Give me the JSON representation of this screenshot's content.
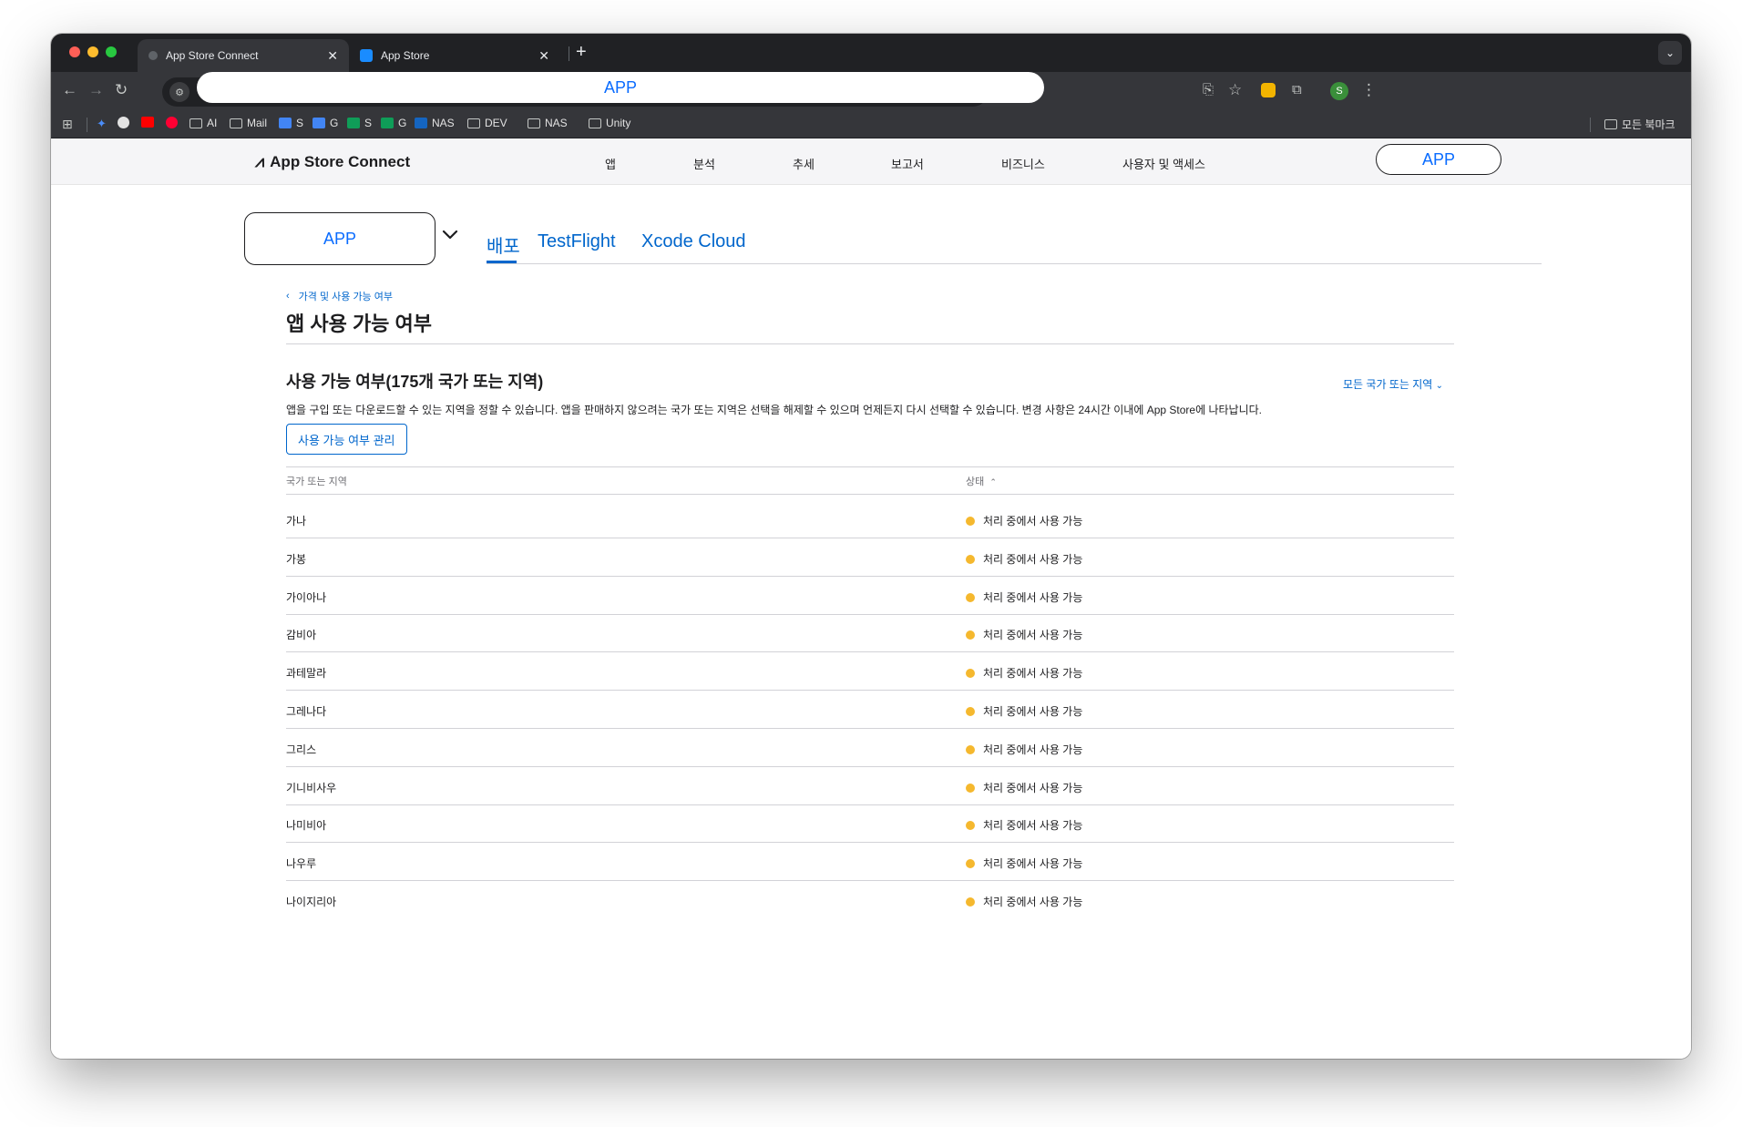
{
  "browser": {
    "tabs": [
      {
        "title": "App Store Connect",
        "active": true
      },
      {
        "title": "App Store",
        "active": false
      }
    ],
    "new_tab_label": "+",
    "address": "APP",
    "bookmarks": [
      {
        "label": "AI",
        "icon": "folder-icon"
      },
      {
        "label": "Mail",
        "icon": "folder-icon"
      },
      {
        "label": "S",
        "icon": "docs-icon"
      },
      {
        "label": "G",
        "icon": "docs-icon"
      },
      {
        "label": "S",
        "icon": "sheets-icon"
      },
      {
        "label": "G",
        "icon": "sheets-icon"
      },
      {
        "label": "NAS",
        "icon": "dsm-icon"
      },
      {
        "label": "DEV",
        "icon": "folder-icon"
      },
      {
        "label": "NAS",
        "icon": "folder-icon"
      },
      {
        "label": "Unity",
        "icon": "folder-icon"
      }
    ],
    "all_bookmarks_label": "모든 북마크",
    "profile_initial": "S",
    "colors": {
      "chrome_dark": "#202124",
      "chrome_mid": "#35363a"
    }
  },
  "asc": {
    "logo_label": "App Store Connect",
    "nav": [
      "앱",
      "분석",
      "추세",
      "보고서",
      "비즈니스",
      "사용자 및 액세스"
    ],
    "account_label": "APP",
    "app_selector_label": "APP",
    "subtabs": [
      "배포",
      "TestFlight",
      "Xcode Cloud"
    ],
    "accent_color": "#0066cc"
  },
  "main": {
    "breadcrumb": "가격 및 사용 가능 여부",
    "title": "앱 사용 가능 여부",
    "section_title": "사용 가능 여부(175개 국가 또는 지역)",
    "filter_label": "모든 국가 또는 지역",
    "description": "앱을 구입 또는 다운로드할 수 있는 지역을 정할 수 있습니다. 앱을 판매하지 않으려는 국가 또는 지역은 선택을 해제할 수 있으며 언제든지 다시 선택할 수 있습니다. 변경 사항은 24시간 이내에 App Store에 나타납니다.",
    "manage_button": "사용 가능 여부 관리",
    "table": {
      "col_country": "국가 또는 지역",
      "col_status": "상태",
      "status_color": "#f5b82e",
      "rows": [
        {
          "country": "가나",
          "status": "처리 중에서 사용 가능"
        },
        {
          "country": "가봉",
          "status": "처리 중에서 사용 가능"
        },
        {
          "country": "가이아나",
          "status": "처리 중에서 사용 가능"
        },
        {
          "country": "감비아",
          "status": "처리 중에서 사용 가능"
        },
        {
          "country": "과테말라",
          "status": "처리 중에서 사용 가능"
        },
        {
          "country": "그레나다",
          "status": "처리 중에서 사용 가능"
        },
        {
          "country": "그리스",
          "status": "처리 중에서 사용 가능"
        },
        {
          "country": "기니비사우",
          "status": "처리 중에서 사용 가능"
        },
        {
          "country": "나미비아",
          "status": "처리 중에서 사용 가능"
        },
        {
          "country": "나우루",
          "status": "처리 중에서 사용 가능"
        },
        {
          "country": "나이지리아",
          "status": "처리 중에서 사용 가능"
        }
      ]
    }
  }
}
